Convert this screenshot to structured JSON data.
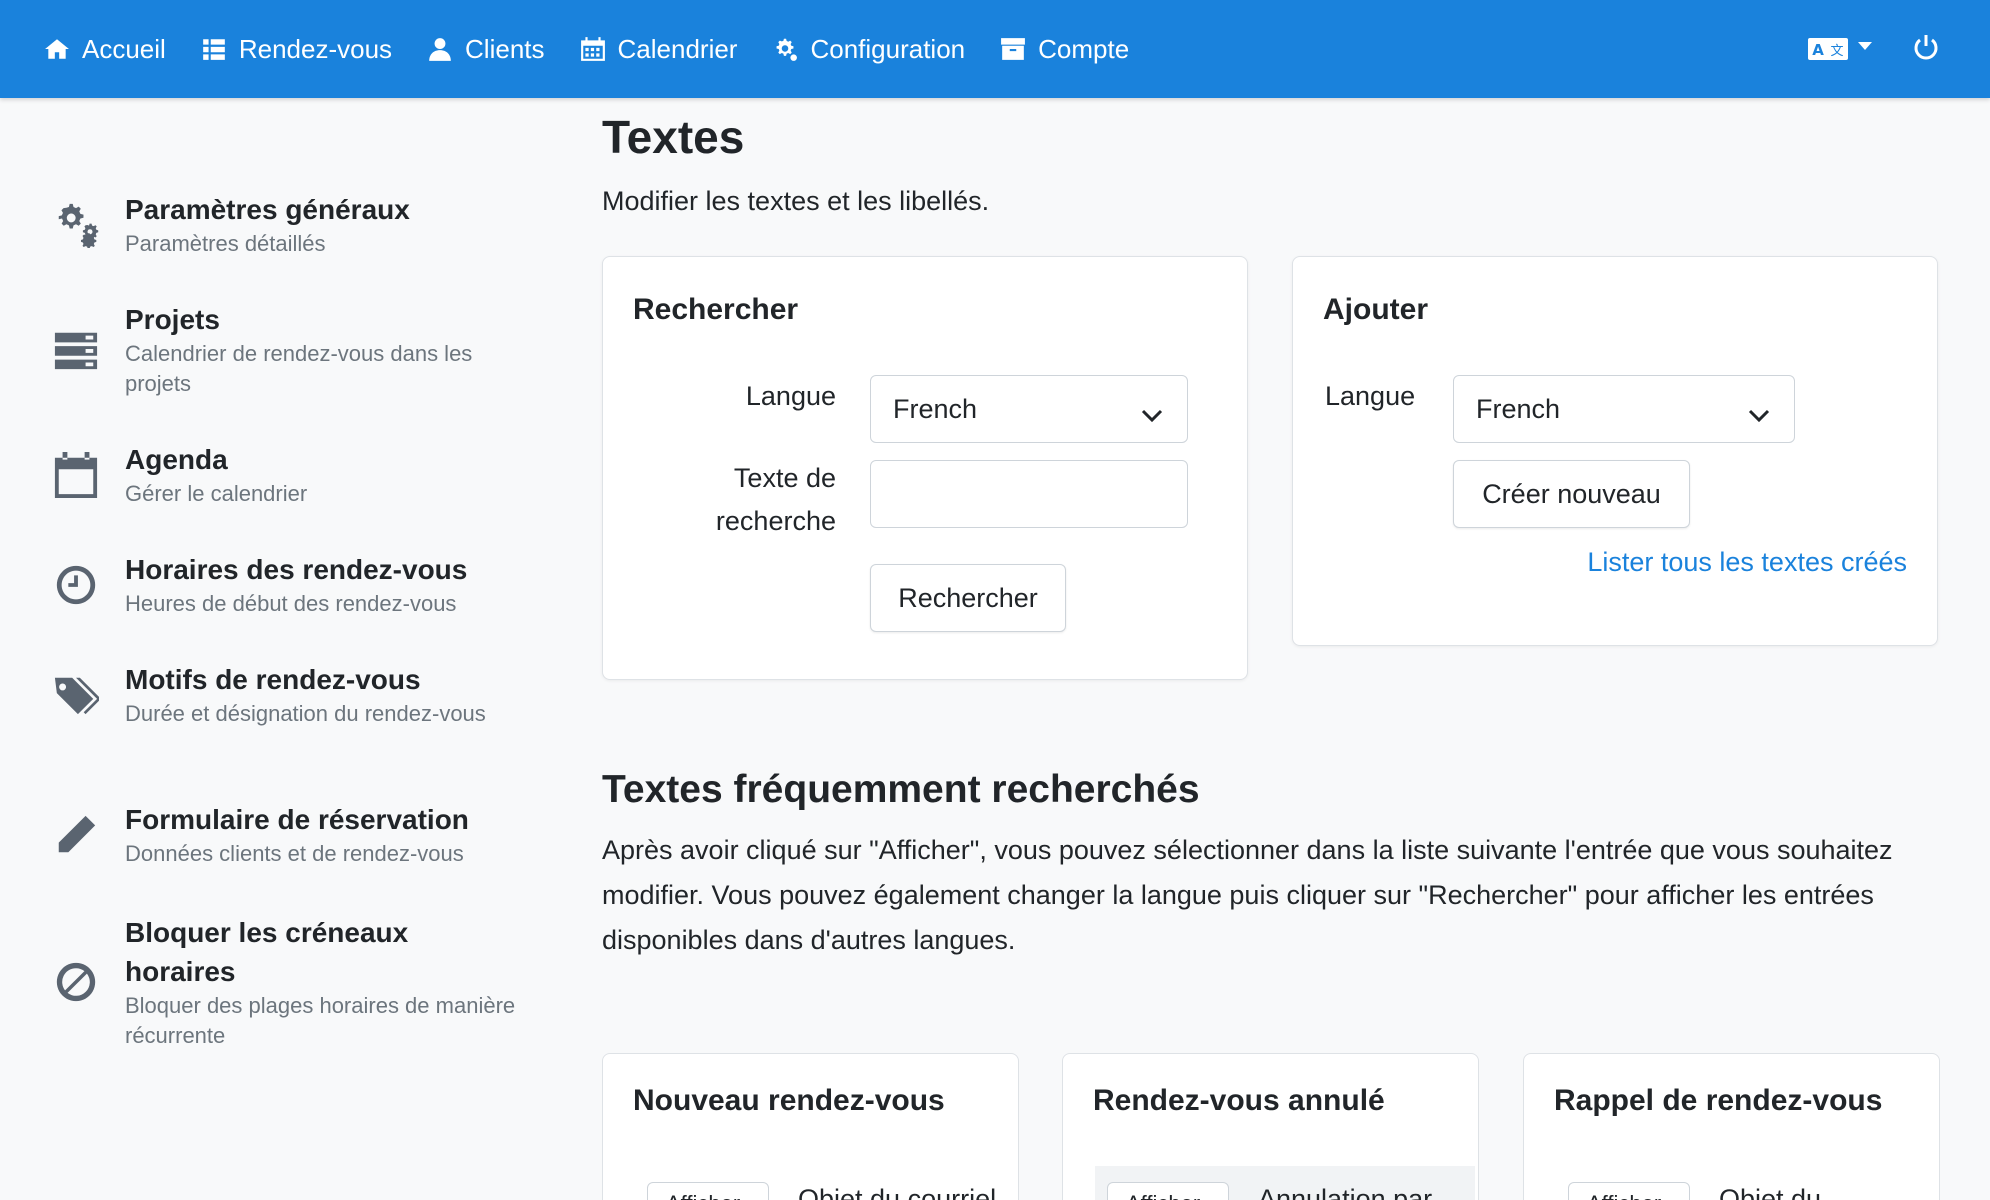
{
  "navbar": {
    "items": [
      {
        "label": "Accueil",
        "icon": "home-icon"
      },
      {
        "label": "Rendez-vous",
        "icon": "list-icon"
      },
      {
        "label": "Clients",
        "icon": "user-icon"
      },
      {
        "label": "Calendrier",
        "icon": "calendar-icon"
      },
      {
        "label": "Configuration",
        "icon": "cogs-icon"
      },
      {
        "label": "Compte",
        "icon": "archive-icon"
      }
    ],
    "bg_color": "#1a82dc"
  },
  "sidebar": {
    "items": [
      {
        "title": "Paramètres généraux",
        "subtitle": "Paramètres détaillés",
        "icon": "cogs-icon"
      },
      {
        "title": "Projets",
        "subtitle": "Calendrier de rendez-vous dans les projets",
        "icon": "server-icon"
      },
      {
        "title": "Agenda",
        "subtitle": "Gérer le calendrier",
        "icon": "calendar-icon"
      },
      {
        "title": "Horaires des rendez-vous",
        "subtitle": "Heures de début des rendez-vous",
        "icon": "clock-icon"
      },
      {
        "title": "Motifs de rendez-vous",
        "subtitle": "Durée et désignation du rendez-vous",
        "icon": "tags-icon"
      },
      {
        "title": "Formulaire de réservation",
        "subtitle": "Données clients et de rendez-vous",
        "icon": "pencil-icon"
      },
      {
        "title": "Bloquer les créneaux horaires",
        "subtitle": "Bloquer des plages horaires de manière récurrente",
        "icon": "ban-icon"
      }
    ]
  },
  "page": {
    "title": "Textes",
    "subtitle": "Modifier les textes et les libellés."
  },
  "search_card": {
    "title": "Rechercher",
    "language_label": "Langue",
    "language_value": "French",
    "search_text_label_1": "Texte de",
    "search_text_label_2": "recherche",
    "search_text_value": "",
    "search_button": "Rechercher"
  },
  "add_card": {
    "title": "Ajouter",
    "language_label": "Langue",
    "language_value": "French",
    "create_button": "Créer nouveau",
    "list_link": "Lister tous les textes créés"
  },
  "frequent": {
    "title": "Textes fréquemment recherchés",
    "description": "Après avoir cliqué sur \"Afficher\", vous pouvez sélectionner dans la liste suivante l'entrée que vous souhaitez modifier. Vous pouvez également changer la langue puis cliquer sur \"Rechercher\" pour afficher les entrées disponibles dans d'autres langues.",
    "cards": [
      {
        "title": "Nouveau rendez-vous",
        "button": "Afficher",
        "row_text": "Objet du courriel"
      },
      {
        "title": "Rendez-vous annulé",
        "button": "Afficher",
        "row_text": "Annulation par"
      },
      {
        "title": "Rappel de rendez-vous",
        "button": "Afficher",
        "row_text": "Objet du"
      }
    ]
  }
}
